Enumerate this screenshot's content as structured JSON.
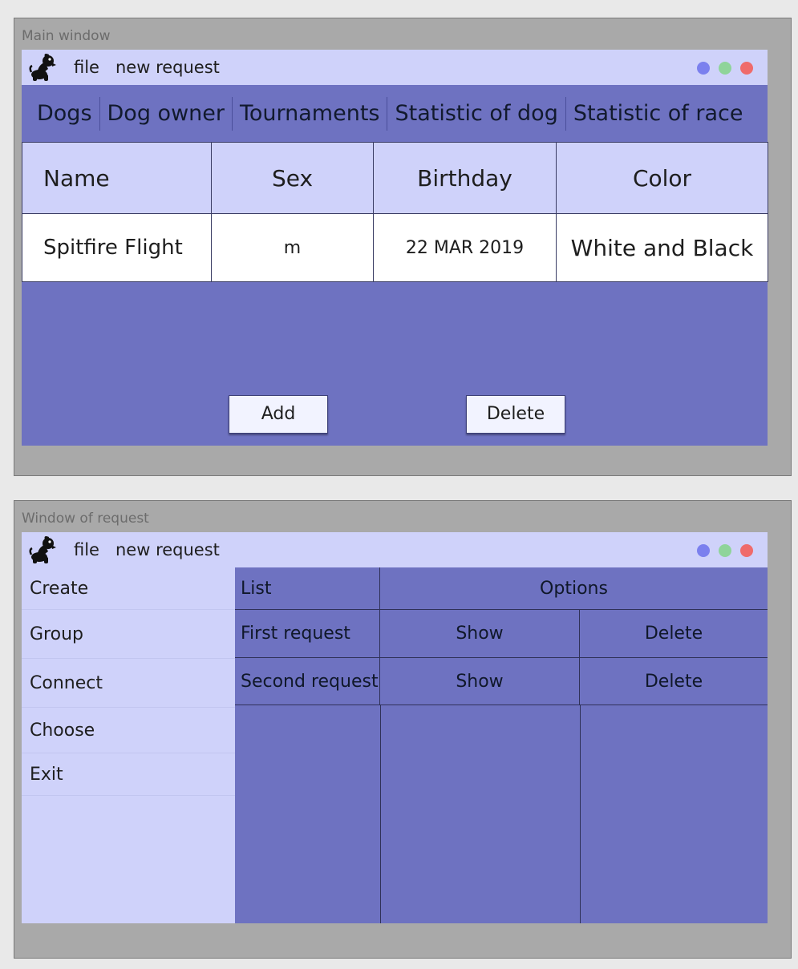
{
  "main_window": {
    "frame_title": "Main window",
    "menu": {
      "file": "file",
      "new_request": "new request"
    },
    "tabs": [
      "Dogs",
      "Dog owner",
      "Tournaments",
      "Statistic of dog",
      "Statistic of race"
    ],
    "table": {
      "headers": [
        "Name",
        "Sex",
        "Birthday",
        "Color"
      ],
      "rows": [
        {
          "name": "Spitfire Flight",
          "sex": "m",
          "birthday": "22 MAR 2019",
          "color": "White and Black"
        }
      ]
    },
    "buttons": {
      "add": "Add",
      "delete": "Delete"
    }
  },
  "request_window": {
    "frame_title": "Window of request",
    "menu": {
      "file": "file",
      "new_request": "new request"
    },
    "sidebar": [
      "Create",
      "Group",
      "Connect",
      "Choose",
      "Exit"
    ],
    "list": {
      "header_list": "List",
      "header_options": "Options",
      "rows": [
        {
          "name": "First request",
          "show": "Show",
          "delete": "Delete"
        },
        {
          "name": "Second request",
          "show": "Show",
          "delete": "Delete"
        }
      ]
    }
  },
  "icons": {
    "app": "dog-icon"
  },
  "colors": {
    "frame": "#a9a9a9",
    "titlebar": "#cfd2fa",
    "accent": "#6e72c1",
    "dot_blue": "#7b80ee",
    "dot_green": "#8fd49a",
    "dot_red": "#ef6b6b"
  }
}
